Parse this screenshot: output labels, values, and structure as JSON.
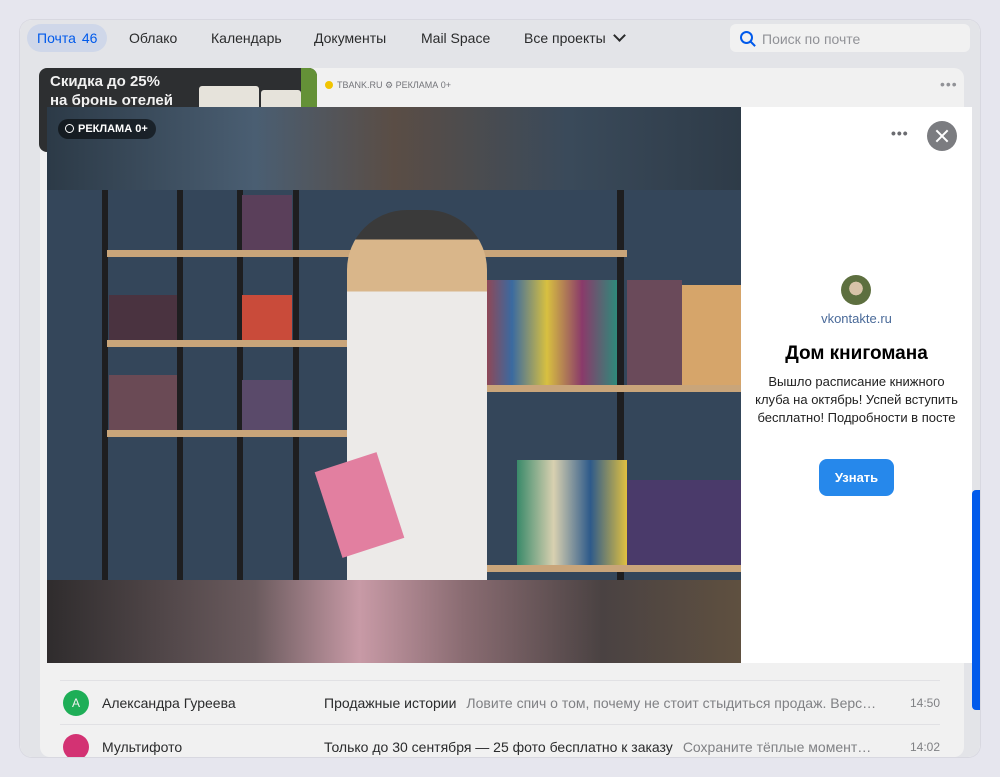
{
  "topnav": {
    "mail_label": "Почта",
    "mail_count": "46",
    "cloud": "Облако",
    "calendar": "Календарь",
    "documents": "Документы",
    "mail_space": "Mail Space",
    "all_projects": "Все проекты",
    "search_placeholder": "Поиск по почте"
  },
  "ad_banner": {
    "line1": "Скидка до 25%",
    "line2": "на бронь отелей",
    "sponsor": "TBANK.RU ⚙ РЕКЛАМА 0+"
  },
  "modal": {
    "ad_label": "РЕКЛАМА 0+",
    "advertiser_site": "vkontakte.ru",
    "title": "Дом книгомана",
    "text": "Вышло расписание книжного клуба на октябрь! Успей вступить бесплатно! Подробности в посте",
    "button": "Узнать"
  },
  "mail_list": [
    {
      "avatar_letter": "А",
      "avatar_color": "#1fb85c",
      "sender": "Александра Гуреева",
      "subject": "Продажные истории",
      "snippet": "Ловите спич о том, почему не стоит стыдиться продаж. Верс…",
      "time": "14:50"
    },
    {
      "avatar_letter": "",
      "avatar_color": "#e0357a",
      "sender": "Мультифото",
      "subject": "Только до 30 сентября — 25 фото бесплатно к заказу",
      "snippet": "Сохраните тёплые момент…",
      "time": "14:02"
    }
  ],
  "colors": {
    "accent": "#005ff9",
    "cta": "#2688eb"
  }
}
